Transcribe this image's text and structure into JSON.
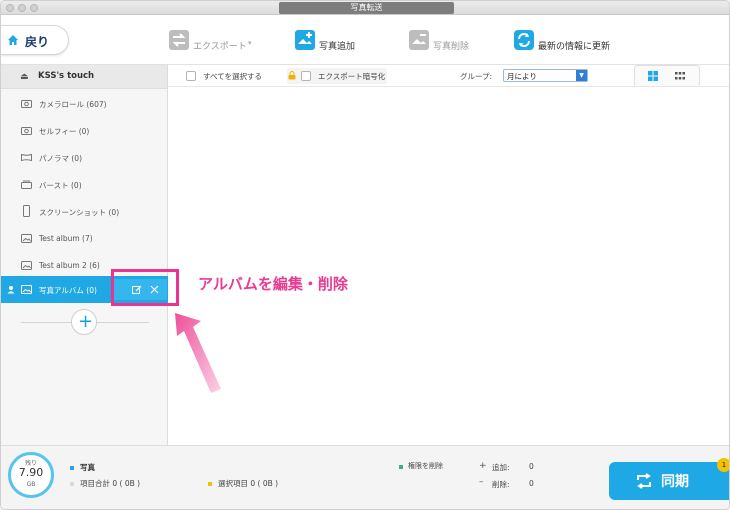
{
  "window": {
    "title": "写真転送"
  },
  "toolbar": {
    "back_label": "戻り",
    "export_label": "エクスポート",
    "add_photo_label": "写真追加",
    "delete_photo_label": "写真削除",
    "refresh_label": "最新の情報に更新"
  },
  "sidebar": {
    "device_name": "KSS's touch",
    "items": [
      {
        "label": "カメラロール (607)",
        "icon": "camera-icon"
      },
      {
        "label": "セルフィー (0)",
        "icon": "camera-icon"
      },
      {
        "label": "パノラマ (0)",
        "icon": "panorama-icon"
      },
      {
        "label": "バースト (0)",
        "icon": "burst-icon"
      },
      {
        "label": "スクリーンショット (0)",
        "icon": "phone-icon"
      },
      {
        "label": "Test album  (7)",
        "icon": "album-icon"
      },
      {
        "label": "Test album 2 (6)",
        "icon": "album-icon"
      },
      {
        "label": "写真アルバム (0)",
        "icon": "album-icon"
      }
    ]
  },
  "filter": {
    "select_all_label": "すべてを選択する",
    "encrypt_label": "エクスポート暗号化",
    "group_label": "グループ:",
    "group_value": "月により"
  },
  "annotation": {
    "text": "アルバムを編集・削除"
  },
  "status": {
    "remaining_label": "残り",
    "remaining_value": "7.90",
    "remaining_unit": "GB",
    "photo_label": "写真",
    "total_items": "項目合計 0 ( 0B )",
    "selected_items": "選択項目 0 ( 0B )",
    "remove_permission": "権限を削除",
    "add_label": "追加:",
    "add_value": "0",
    "delete_label": "削除:",
    "delete_value": "0",
    "sync_label": "同期",
    "badge_count": "1"
  },
  "colors": {
    "accent": "#1fa8e4",
    "annotation": "#e9358f"
  }
}
